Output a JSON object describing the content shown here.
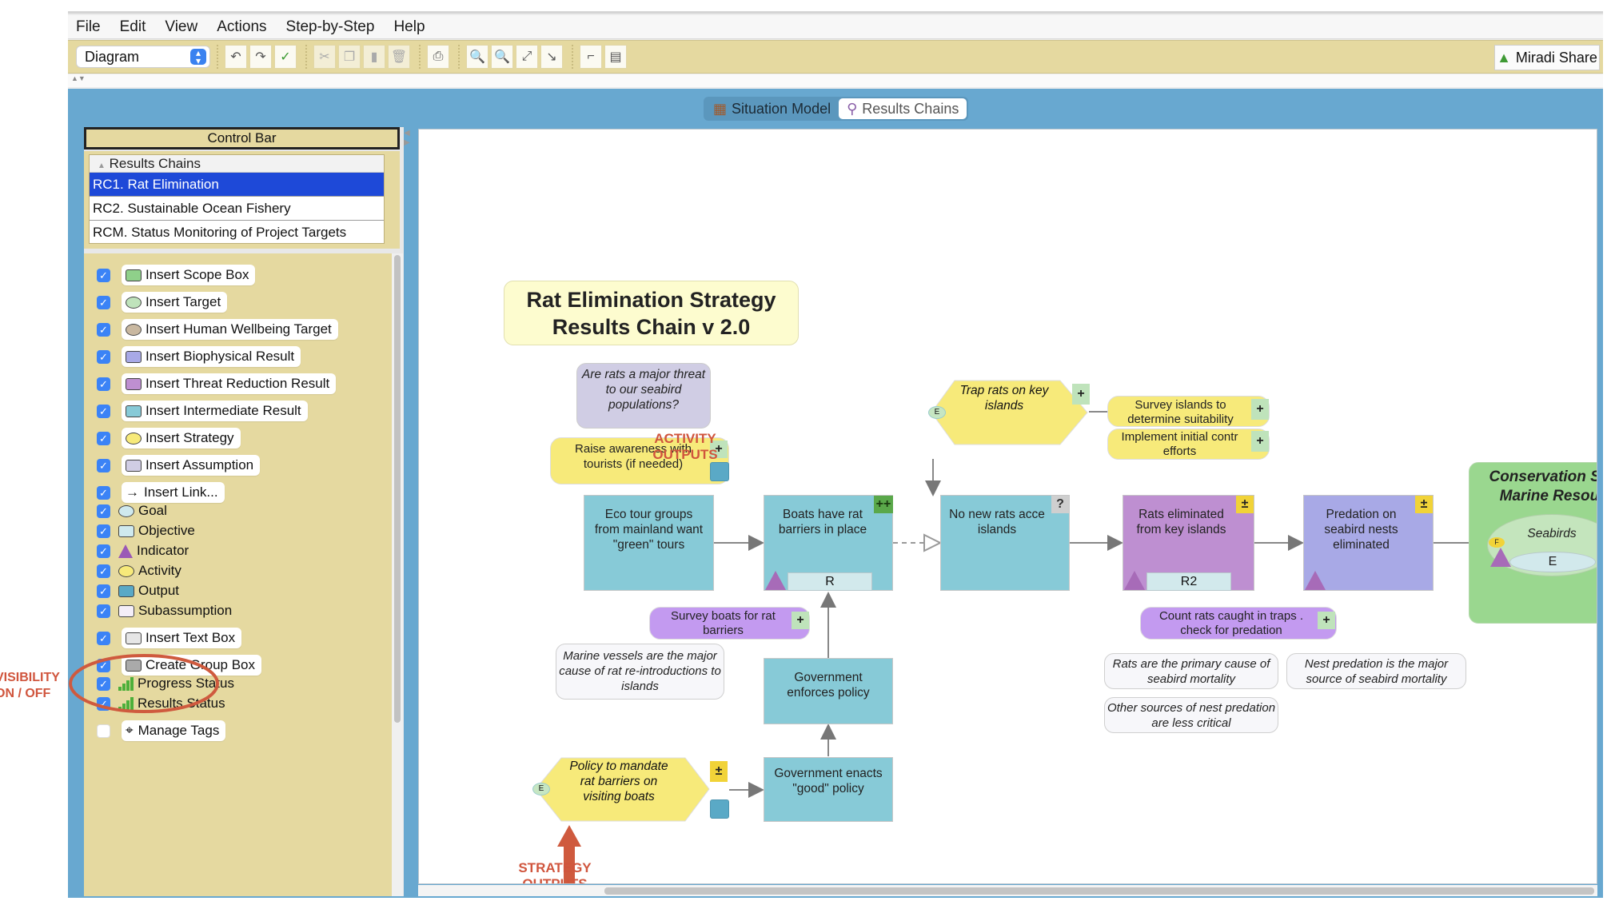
{
  "menu": [
    "File",
    "Edit",
    "View",
    "Actions",
    "Step-by-Step",
    "Help"
  ],
  "toolbar": {
    "view_select": "Diagram",
    "buttons": [
      {
        "name": "undo-icon",
        "glyph": "↶"
      },
      {
        "name": "redo-icon",
        "glyph": "↷"
      },
      {
        "name": "spellcheck-icon",
        "glyph": "✓"
      },
      {
        "name": "cut-icon",
        "glyph": "✂"
      },
      {
        "name": "copy-icon",
        "glyph": "❐"
      },
      {
        "name": "paste-icon",
        "glyph": "▮"
      },
      {
        "name": "delete-icon",
        "glyph": "🗑"
      },
      {
        "name": "print-icon",
        "glyph": "⎙"
      },
      {
        "name": "zoom-in-icon",
        "glyph": "🔍"
      },
      {
        "name": "zoom-out-icon",
        "glyph": "🔍"
      },
      {
        "name": "zoom-fit-icon",
        "glyph": "⤢"
      },
      {
        "name": "pointer-icon",
        "glyph": "↘"
      },
      {
        "name": "link-routing-icon",
        "glyph": "⌐"
      },
      {
        "name": "layers-icon",
        "glyph": "▤"
      }
    ],
    "share_label": "Miradi Share"
  },
  "view_tabs": [
    {
      "label": "Situation Model",
      "selected": false
    },
    {
      "label": "Results Chains",
      "selected": true
    }
  ],
  "control_bar": {
    "title": "Control Bar",
    "results_chains_header": "Results Chains",
    "results_chains": [
      {
        "label": "RC1. Rat Elimination",
        "selected": true
      },
      {
        "label": "RC2. Sustainable Ocean Fishery",
        "selected": false
      },
      {
        "label": "RCM. Status Monitoring of Project Targets",
        "selected": false
      }
    ],
    "legend": [
      {
        "label": "Insert Scope Box",
        "checked": true,
        "button": true,
        "swatch": "#8fd08a",
        "shape": "rect"
      },
      {
        "label": "Insert Target",
        "checked": true,
        "button": true,
        "swatch": "#bfe3bb",
        "shape": "oval"
      },
      {
        "label": "Insert Human Wellbeing Target",
        "checked": true,
        "button": true,
        "swatch": "#c9b8a0",
        "shape": "oval"
      },
      {
        "label": "Insert Biophysical Result",
        "checked": true,
        "button": true,
        "swatch": "#a8a9e6",
        "shape": "rect"
      },
      {
        "label": "Insert Threat Reduction Result",
        "checked": true,
        "button": true,
        "swatch": "#be8fd1",
        "shape": "rect"
      },
      {
        "label": "Insert Intermediate Result",
        "checked": true,
        "button": true,
        "swatch": "#87cad7",
        "shape": "rect"
      },
      {
        "label": "Insert Strategy",
        "checked": true,
        "button": true,
        "swatch": "#f7ea7a",
        "shape": "hex"
      },
      {
        "label": "Insert Assumption",
        "checked": true,
        "button": true,
        "swatch": "#d0cde4",
        "shape": "rect"
      },
      {
        "label": "Insert Link...",
        "checked": true,
        "button": true,
        "swatch": null,
        "shape": "arrow"
      },
      {
        "label": "Goal",
        "checked": true,
        "button": false,
        "swatch": "#cfe9ee",
        "shape": "oval"
      },
      {
        "label": "Objective",
        "checked": true,
        "button": false,
        "swatch": "#cfe9ee",
        "shape": "rect"
      },
      {
        "label": "Indicator",
        "checked": true,
        "button": false,
        "swatch": "#9b59b6",
        "shape": "triangle"
      },
      {
        "label": "Activity",
        "checked": true,
        "button": false,
        "swatch": "#f7ea7a",
        "shape": "oval"
      },
      {
        "label": "Output",
        "checked": true,
        "button": false,
        "swatch": "#5aa9c6",
        "shape": "rect"
      },
      {
        "label": "Subassumption",
        "checked": true,
        "button": false,
        "swatch": "#f4eef8",
        "shape": "rect"
      },
      {
        "label": "Insert Text Box",
        "checked": true,
        "button": true,
        "swatch": "#e6e6e6",
        "shape": "rect"
      },
      {
        "label": "Create Group Box",
        "checked": true,
        "button": true,
        "swatch": "#aaaaaa",
        "shape": "rect"
      },
      {
        "label": "Progress Status",
        "checked": true,
        "button": false,
        "swatch": "#4caf3a",
        "shape": "bars"
      },
      {
        "label": "Results Status",
        "checked": true,
        "button": false,
        "swatch": "#4caf3a",
        "shape": "bars"
      },
      {
        "label": "Manage Tags",
        "checked": false,
        "button": true,
        "swatch": null,
        "shape": "tag"
      }
    ]
  },
  "diagram": {
    "title_line1": "Rat Elimination Strategy",
    "title_line2": "Results Chain v 2.0",
    "assumption_question": "Are rats a major threat to our seabird populations?",
    "activity_raise": "Raise awareness with tourists (if needed)",
    "ir_eco_tour": "Eco tour groups from mainland want \"green\" tours",
    "ir_boats": "Boats have rat barriers in place",
    "ir_boats_badge": "++",
    "ir_boats_objective": "R",
    "ir_no_new_rats": "No new rats acce islands",
    "ir_no_new_rats_badge": "?",
    "trr_rats_eliminated": "Rats eliminated from key islands",
    "trr_badge": "±",
    "trr_objective": "R2",
    "bio_predation": "Predation on seabird nests eliminated",
    "bio_badge": "±",
    "scope_title": "Conservation Scope: Marine Resources",
    "target_seabirds": "Seabirds",
    "target_goal": "E",
    "target_flag": "F",
    "strategy_trap": "Trap rats on key islands",
    "strategy_trap_tag": "E",
    "activity_survey_islands": "Survey islands to determine suitability",
    "activity_implement": "Implement initial contr efforts",
    "objective_survey_boats": "Survey boats for rat barriers",
    "subassumption_marine": "Marine vessels are the major cause of rat re-introductions to islands",
    "ir_gov_enforces": "Government enforces policy",
    "strategy_policy": "Policy to mandate rat barriers on visiting boats",
    "strategy_policy_tag": "E",
    "strategy_policy_badge": "±",
    "ir_gov_enacts": "Government enacts \"good\" policy",
    "objective_count_rats": "Count rats caught in traps . check for predation",
    "subassumption_rats_primary": "Rats are the primary cause of seabird mortality",
    "subassumption_nest_predation": "Nest predation is the major source of seabird mortality",
    "subassumption_other_sources": "Other sources of nest predation are less critical",
    "plus": "+"
  },
  "annotations": {
    "activity_outputs": "ACTIVITY OUTPUTS",
    "strategy_outputs": "STRATEGY OUTPUTS",
    "visibility": "VISIBILITY ON / OFF",
    "color": "#d0553d"
  }
}
